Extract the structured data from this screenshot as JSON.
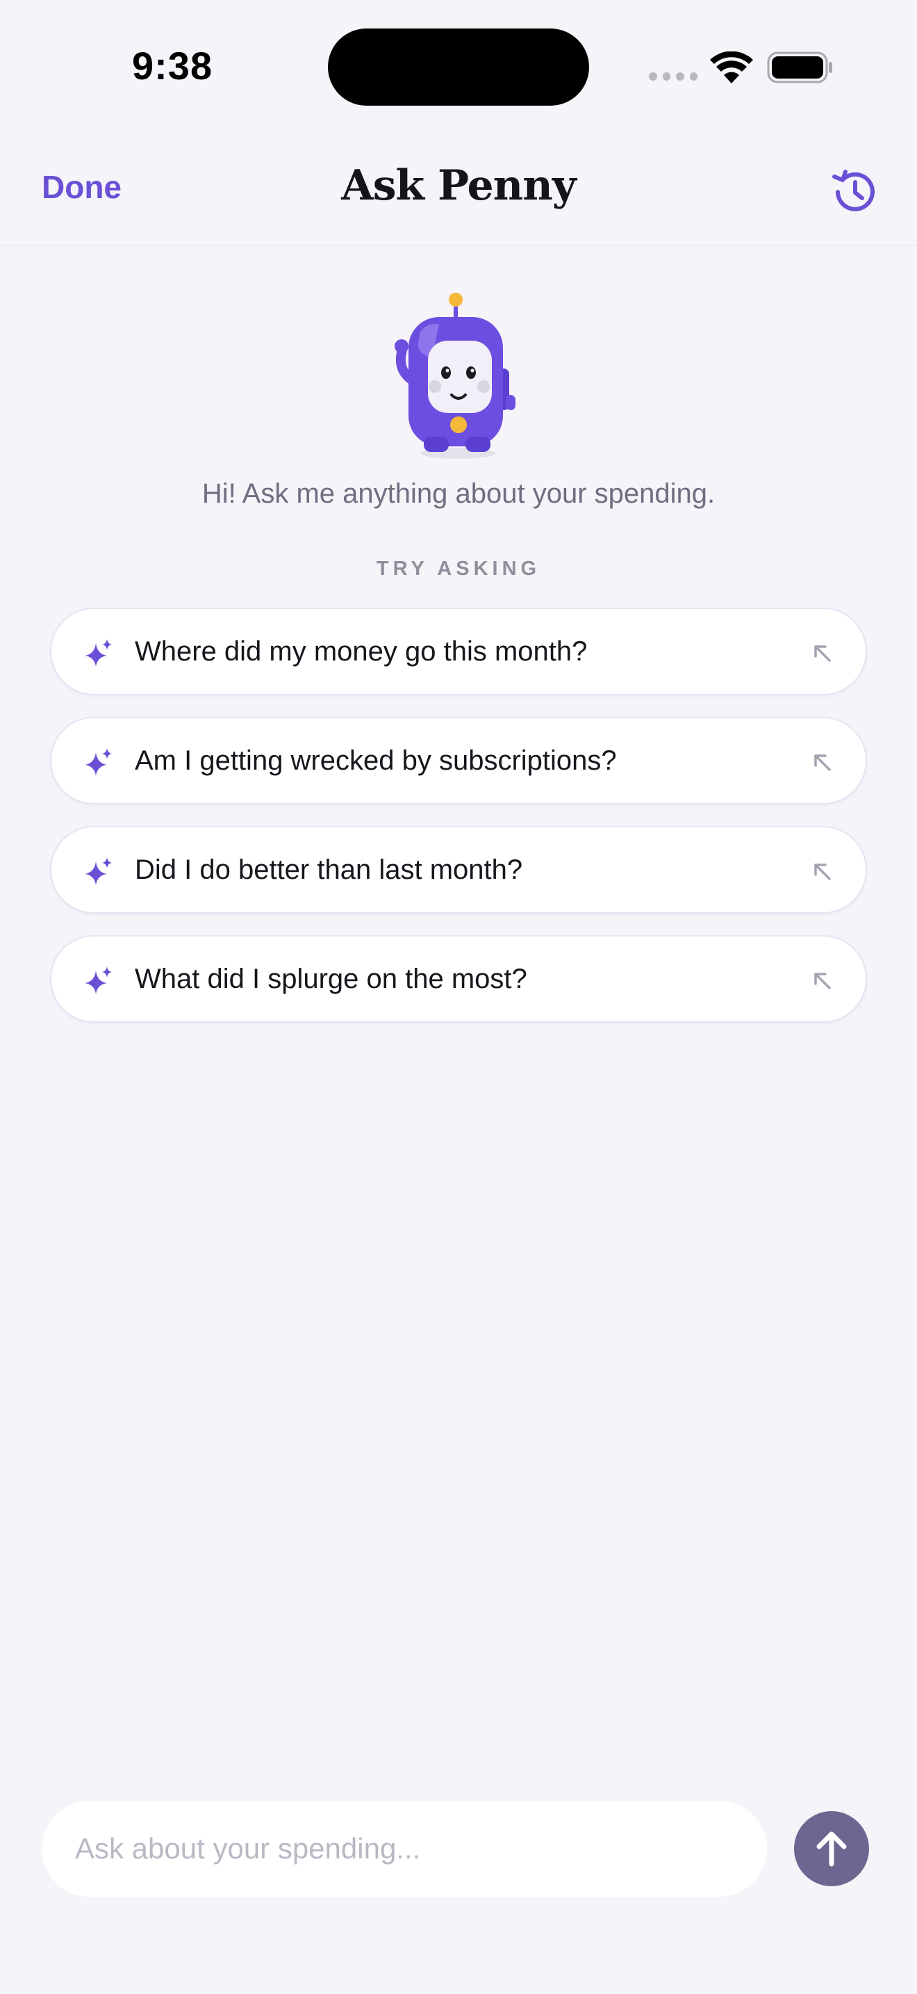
{
  "status_bar": {
    "time": "9:38"
  },
  "nav": {
    "done_label": "Done",
    "title": "Ask Penny",
    "history_icon": "history-icon"
  },
  "mascot": {
    "icon": "robot-mascot"
  },
  "greeting": "Hi! Ask me anything about your spending.",
  "try_asking_label": "TRY ASKING",
  "suggestions": [
    {
      "icon": "sparkle-icon",
      "text": "Where did my money go this month?",
      "action_icon": "arrow-up-left-icon"
    },
    {
      "icon": "sparkle-icon",
      "text": "Am I getting wrecked by subscriptions?",
      "action_icon": "arrow-up-left-icon"
    },
    {
      "icon": "sparkle-icon",
      "text": "Did I do better than last month?",
      "action_icon": "arrow-up-left-icon"
    },
    {
      "icon": "sparkle-icon",
      "text": "What did I splurge on the most?",
      "action_icon": "arrow-up-left-icon"
    }
  ],
  "composer": {
    "placeholder": "Ask about your spending...",
    "value": "",
    "send_icon": "arrow-up-icon"
  },
  "colors": {
    "accent": "#6b50d6",
    "background": "#f4f4f9",
    "send_button": "#6e6690",
    "mascot_body": "#6c4ee0",
    "mascot_antenna": "#f5b93a"
  }
}
